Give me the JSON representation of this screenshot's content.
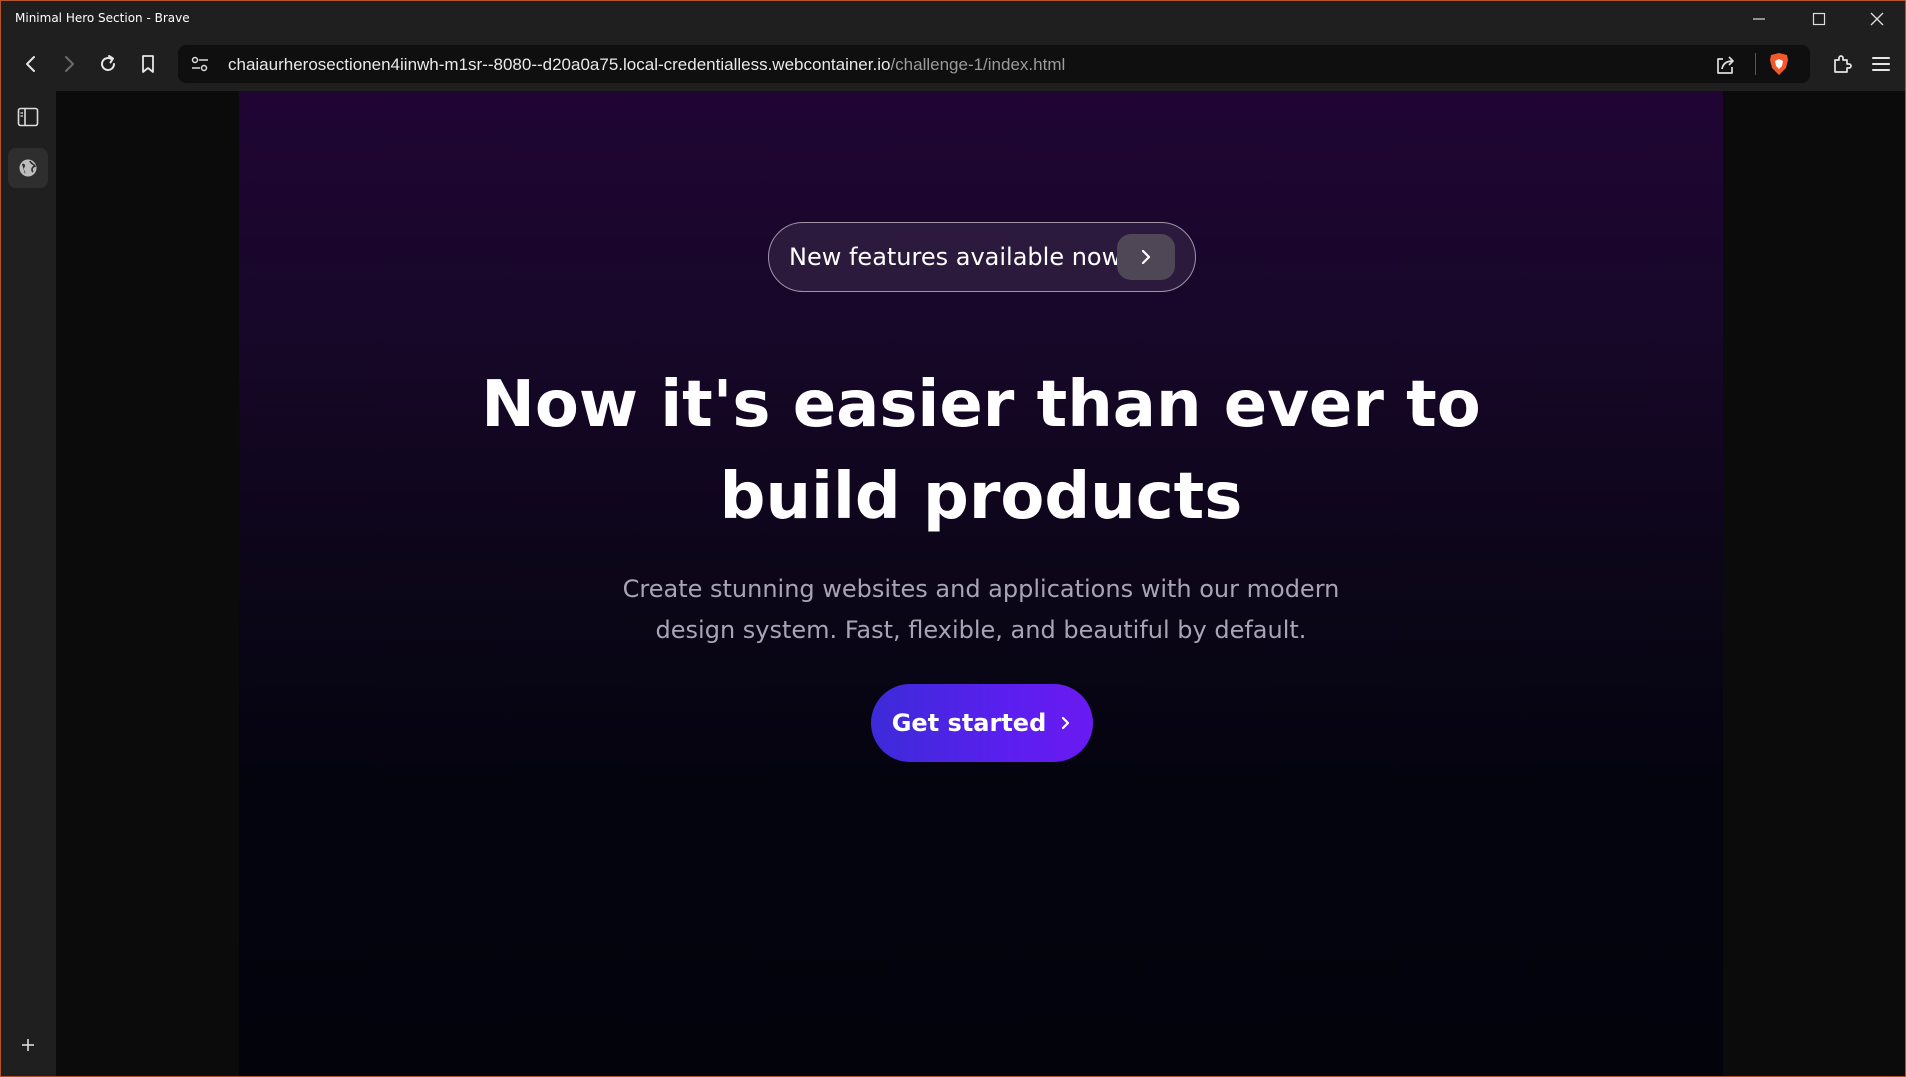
{
  "window": {
    "title": "Minimal Hero Section - Brave"
  },
  "toolbar": {
    "url_host": "chaiaurherosectionen4iinwh-m1sr--8080--d20a0a75.local-credentialless.webcontainer.io",
    "url_path": "/challenge-1/index.html"
  },
  "icons": {
    "back": "back-arrow-icon",
    "forward": "forward-arrow-icon",
    "reload": "reload-icon",
    "bookmark": "bookmark-icon",
    "site_info": "site-settings-icon",
    "share": "share-icon",
    "shields": "brave-shields-icon",
    "extensions": "puzzle-icon",
    "menu": "hamburger-menu-icon",
    "sidebar_toggle": "sidebar-panel-icon",
    "web_panel": "globe-icon",
    "add": "plus-icon"
  },
  "hero": {
    "badge_text": "New features available now.",
    "headline": "Now it's easier than ever to build products",
    "subtext": "Create stunning websites and applications with our modern design system. Fast, flexible, and beautiful by default.",
    "cta_label": "Get started"
  },
  "colors": {
    "hero_top": "#200534",
    "hero_bottom": "#03030c",
    "cta_start": "#3c2bd9",
    "cta_end": "#6a1af2",
    "window_border": "#b5542a",
    "brave_orange": "#f1592a"
  }
}
